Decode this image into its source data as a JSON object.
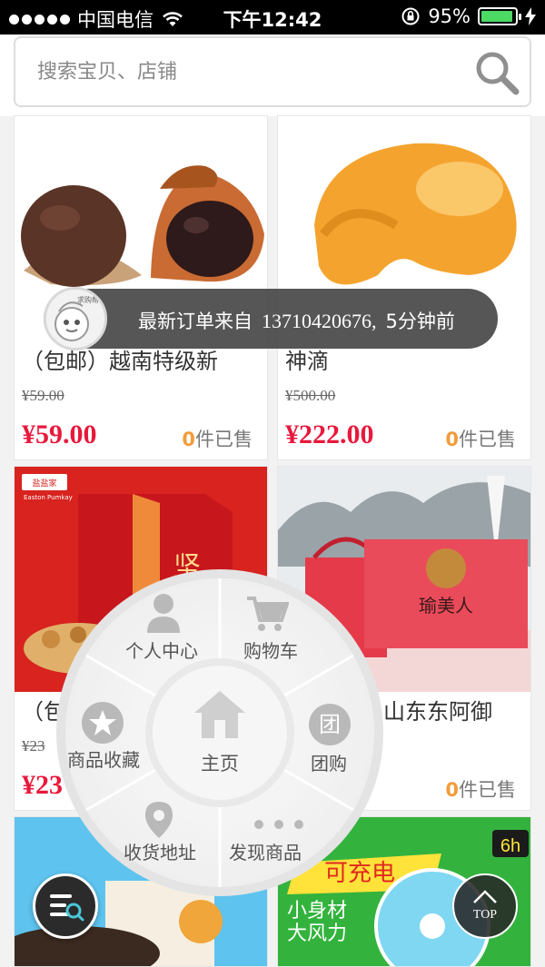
{
  "status_bar": {
    "carrier": "中国电信",
    "time": "下午12:42",
    "battery_percent": "95%",
    "battery_level": 0.95,
    "icons": [
      "signal-dots-icon",
      "wifi-icon",
      "rotation-lock-icon",
      "battery-icon",
      "charging-bolt-icon"
    ]
  },
  "search": {
    "placeholder": "搜索宝贝、店铺",
    "icon": "search-icon"
  },
  "products": [
    {
      "title": "（包邮）越南特级新",
      "old_price": "¥59.00",
      "price": "¥59.00",
      "sold_count": "0",
      "sold_suffix": "件已售"
    },
    {
      "title": "神滴",
      "old_price": "¥500.00",
      "price": "¥222.00",
      "sold_count": "0",
      "sold_suffix": "件已售"
    },
    {
      "title": "（包",
      "old_price": "¥23",
      "price": "¥23",
      "sold_count": "",
      "sold_suffix": ""
    },
    {
      "title": "山东东阿御",
      "old_price": "",
      "price": "",
      "sold_count": "0",
      "sold_suffix": "件已售"
    },
    {
      "title": "",
      "old_price": "",
      "price": "",
      "sold_count": "",
      "sold_suffix": ""
    },
    {
      "title": "",
      "old_price": "",
      "price": "",
      "sold_count": "",
      "sold_suffix": ""
    }
  ],
  "product_images": {
    "card1_brand": "Easton Pumkay",
    "card2_brand": "瑜美人",
    "card5_badge": "6h",
    "card5_text_1": "小身材",
    "card5_text_2": "大风力",
    "card5_banner": "可充电"
  },
  "toast": {
    "avatar_label": "求购帮",
    "prefix": "最新订单来自",
    "phone": "13710420676,",
    "suffix": "5分钟前"
  },
  "radial_menu": {
    "center": "主页",
    "items": [
      {
        "label": "个人中心",
        "icon": "user-icon"
      },
      {
        "label": "购物车",
        "icon": "cart-icon"
      },
      {
        "label": "团购",
        "icon": "group-buy-icon",
        "glyph": "团"
      },
      {
        "label": "发现商品",
        "icon": "more-dots-icon"
      },
      {
        "label": "收货地址",
        "icon": "location-pin-icon"
      },
      {
        "label": "商品收藏",
        "icon": "star-icon"
      }
    ]
  },
  "floating": {
    "top_label": "TOP"
  },
  "colors": {
    "price": "#e8193c",
    "sold_count": "#f39c3a",
    "toast_bg": "#484848",
    "battery": "#4cd964"
  }
}
